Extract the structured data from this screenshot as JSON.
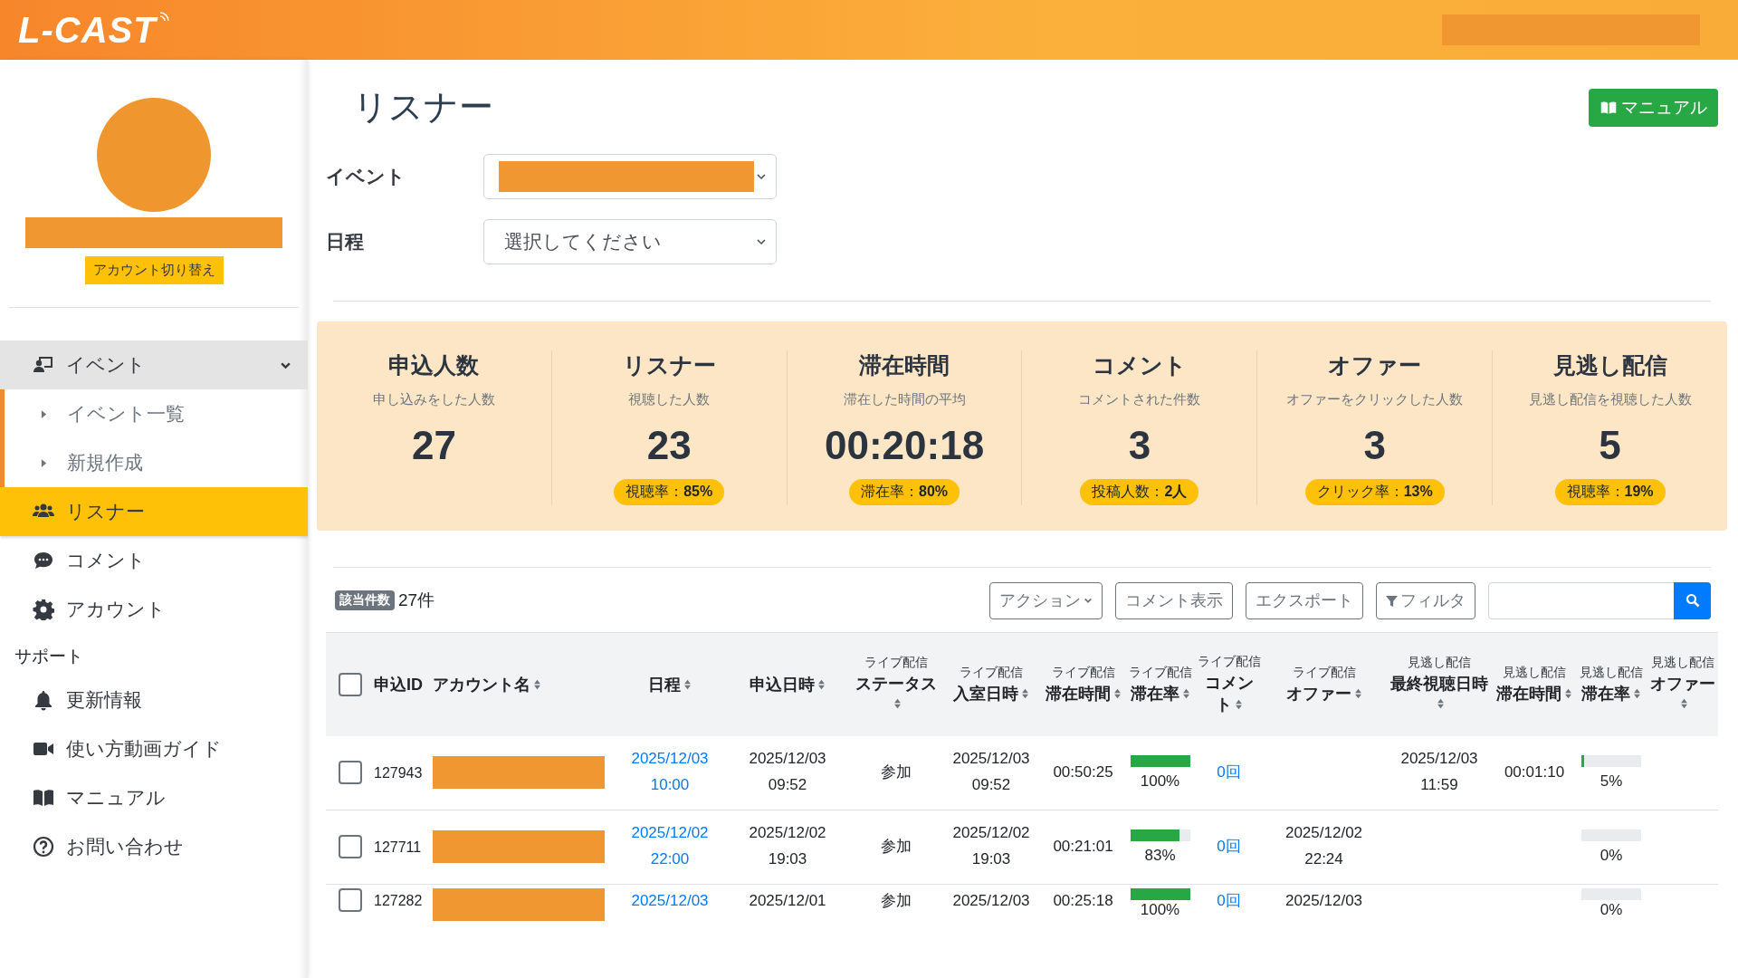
{
  "header": {
    "logo": "L-CAST"
  },
  "sidebar": {
    "switch_button": "アカウント切り替え",
    "items": [
      {
        "kind": "group",
        "label": "イベント",
        "expanded": true,
        "selected": false,
        "children": [
          {
            "label": "イベント一覧",
            "selected": false
          },
          {
            "label": "新規作成",
            "selected": false
          }
        ]
      },
      {
        "kind": "item",
        "label": "リスナー",
        "selected": true
      },
      {
        "kind": "item",
        "label": "コメント",
        "selected": false
      },
      {
        "kind": "item",
        "label": "アカウント",
        "selected": false
      },
      {
        "kind": "heading",
        "label": "サポート"
      },
      {
        "kind": "item",
        "label": "更新情報",
        "selected": false
      },
      {
        "kind": "item",
        "label": "使い方動画ガイド",
        "selected": false
      },
      {
        "kind": "item",
        "label": "マニュアル",
        "selected": false
      },
      {
        "kind": "item",
        "label": "お問い合わせ",
        "selected": false
      }
    ]
  },
  "page": {
    "title": "リスナー",
    "manual_button": "マニュアル"
  },
  "filters": [
    {
      "label": "イベント",
      "kind": "redacted"
    },
    {
      "label": "日程",
      "kind": "select",
      "value": "選択してください"
    }
  ],
  "stats": [
    {
      "title": "申込人数",
      "subtitle": "申し込みをした人数",
      "value": "27"
    },
    {
      "title": "リスナー",
      "subtitle": "視聴した人数",
      "value": "23",
      "badge": "視聴率：**85%**"
    },
    {
      "title": "滞在時間",
      "subtitle": "滞在した時間の平均",
      "value": "00:20:18",
      "badge": "滞在率：**80%**"
    },
    {
      "title": "コメント",
      "subtitle": "コメントされた件数",
      "value": "3",
      "badge": "投稿人数：**2人**"
    },
    {
      "title": "オファー",
      "subtitle": "オファーをクリックした人数",
      "value": "3",
      "badge": "クリック率：**13%**"
    },
    {
      "title": "見逃し配信",
      "subtitle": "見逃し配信を視聴した人数",
      "value": "5",
      "badge": "視聴率：**19%**"
    }
  ],
  "toolbar": {
    "count_label": "該当件数",
    "count": "27件",
    "buttons": [
      {
        "kind": "dropdown",
        "label": "アクション"
      },
      {
        "kind": "plain",
        "label": "コメント表示"
      },
      {
        "kind": "plain",
        "label": "エクスポート"
      },
      {
        "kind": "filter",
        "label": "フィルタ"
      }
    ]
  },
  "table": {
    "select_all": {
      "checked": false
    },
    "columns": [
      {
        "label": "申込ID",
        "sortable": false
      },
      {
        "label": "アカウント名",
        "sortable": true
      },
      {
        "label": "日程",
        "sortable": true
      },
      {
        "label": "申込日時",
        "sortable": true
      },
      {
        "sub": "ライブ配信",
        "label": "ステータス",
        "sortable": true
      },
      {
        "sub": "ライブ配信",
        "label": "入室日時",
        "sortable": true
      },
      {
        "sub": "ライブ配信",
        "label": "滞在時間",
        "sortable": true
      },
      {
        "sub": "ライブ配信",
        "label": "滞在率",
        "sortable": true
      },
      {
        "sub": "ライブ配信",
        "label": "コメント",
        "sortable": true
      },
      {
        "sub": "ライブ配信",
        "label": "オファー",
        "sortable": true
      },
      {
        "sub": "見逃し配信",
        "label": "最終視聴日時",
        "sortable": true
      },
      {
        "sub": "見逃し配信",
        "label": "滞在時間",
        "sortable": true
      },
      {
        "sub": "見逃し配信",
        "label": "滞在率",
        "sortable": true
      },
      {
        "sub": "見逃し配信",
        "label": "オファー",
        "sortable": true
      }
    ],
    "rows": [
      {
        "checked": false,
        "id": "127943",
        "schedule": "2025/12/03\n10:00",
        "applied": "2025/12/03\n09:52",
        "status": "参加",
        "entered": "2025/12/03\n09:52",
        "stay": "00:50:25",
        "stay_rate": {
          "level": 1,
          "text": "100%"
        },
        "comments": "0回",
        "offer": "",
        "missed_last": "2025/12/03\n11:59",
        "missed_stay": "00:01:10",
        "missed_rate": {
          "level": 0.05,
          "text": "5%"
        }
      },
      {
        "checked": false,
        "id": "127711",
        "schedule": "2025/12/02\n22:00",
        "applied": "2025/12/02\n19:03",
        "status": "参加",
        "entered": "2025/12/02\n19:03",
        "stay": "00:21:01",
        "stay_rate": {
          "level": 0.83,
          "text": "83%"
        },
        "comments": "0回",
        "offer": "2025/12/02\n22:24",
        "missed_last": "",
        "missed_stay": "",
        "missed_rate": {
          "level": 0,
          "text": "0%"
        }
      },
      {
        "checked": false,
        "id": "127282",
        "schedule": "2025/12/03",
        "applied": "2025/12/01",
        "status": "参加",
        "entered": "2025/12/03",
        "stay": "00:25:18",
        "stay_rate": {
          "level": 1,
          "text": "100%"
        },
        "comments": "0回",
        "offer": "2025/12/03",
        "missed_last": "",
        "missed_stay": "",
        "missed_rate": {
          "level": 0,
          "text": "0%"
        }
      }
    ]
  }
}
